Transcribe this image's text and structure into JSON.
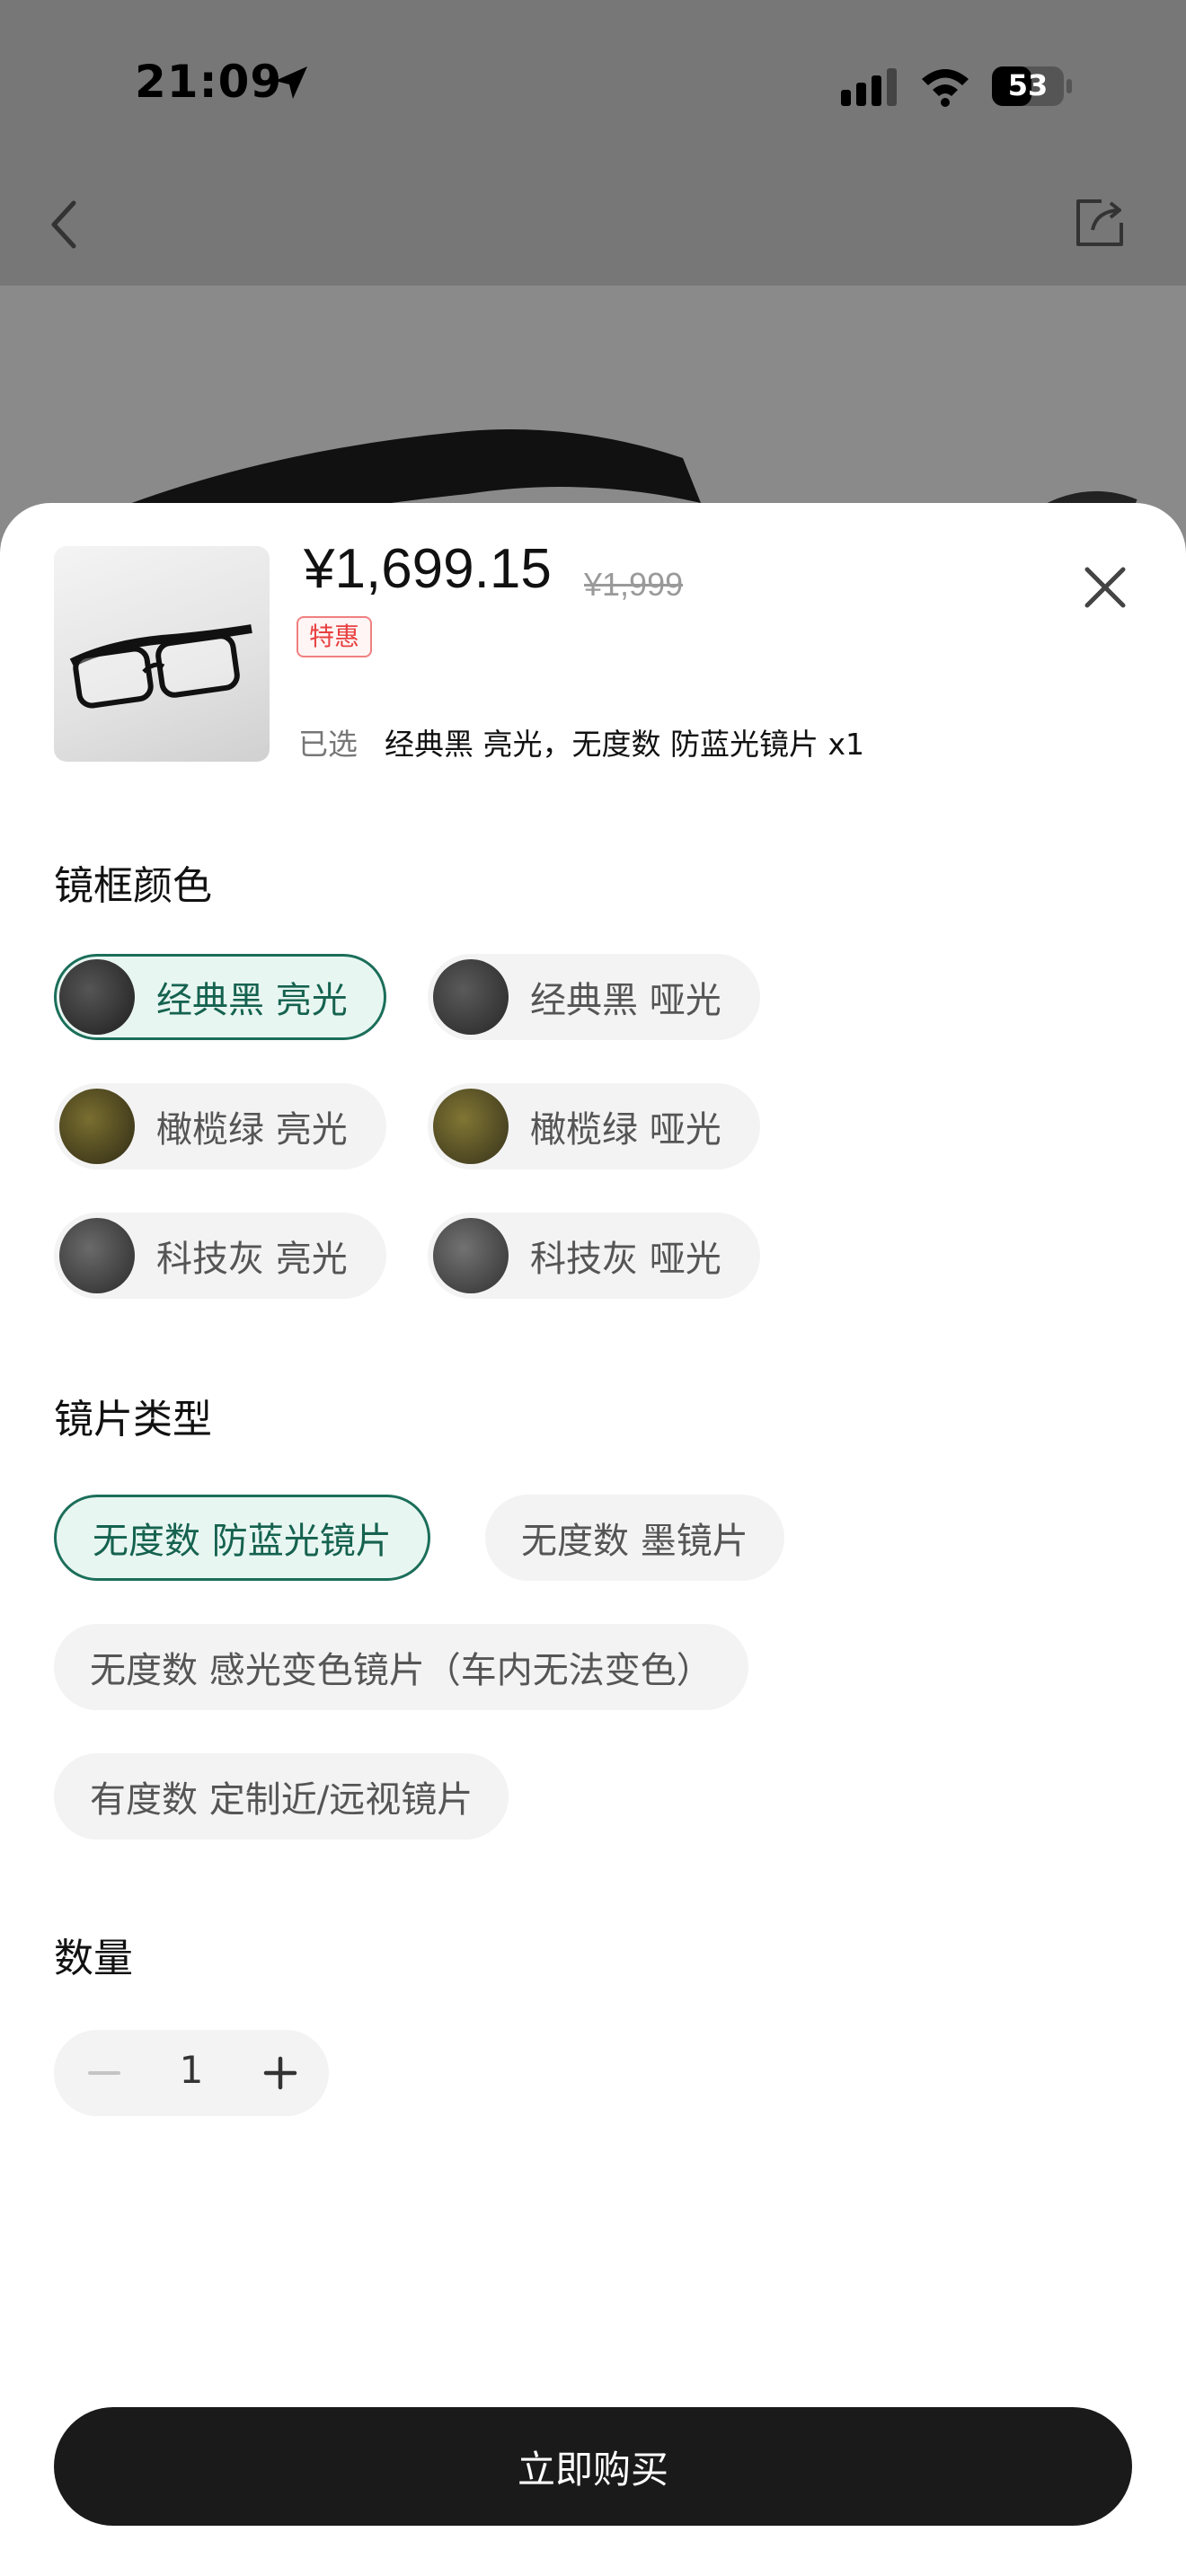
{
  "status_bar": {
    "time": "21:09",
    "battery": "53"
  },
  "product": {
    "price": "¥1,699.15",
    "original_price": "¥1,999",
    "badge": "特惠",
    "selected_label": "已选",
    "selected_value": "经典黑 亮光，无度数 防蓝光镜片 x1"
  },
  "frame_color": {
    "title": "镜框颜色",
    "options": [
      {
        "label": "经典黑 亮光",
        "selected": true,
        "swatch": "#2a2a2a"
      },
      {
        "label": "经典黑 哑光",
        "selected": false,
        "swatch": "#333333"
      },
      {
        "label": "橄榄绿 亮光",
        "selected": false,
        "swatch": "#4a4420"
      },
      {
        "label": "橄榄绿 哑光",
        "selected": false,
        "swatch": "#545025"
      },
      {
        "label": "科技灰 亮光",
        "selected": false,
        "swatch": "#3c3c3c"
      },
      {
        "label": "科技灰 哑光",
        "selected": false,
        "swatch": "#444444"
      }
    ]
  },
  "lens_type": {
    "title": "镜片类型",
    "options": [
      {
        "label": "无度数 防蓝光镜片",
        "selected": true
      },
      {
        "label": "无度数 墨镜片",
        "selected": false
      },
      {
        "label": "无度数 感光变色镜片（车内无法变色）",
        "selected": false
      },
      {
        "label": "有度数 定制近/远视镜片",
        "selected": false
      }
    ]
  },
  "quantity": {
    "title": "数量",
    "value": "1"
  },
  "buy_button": {
    "label": "立即购买"
  },
  "colors": {
    "accent": "#1b6e5a",
    "accent_bg": "#e8f6f1",
    "deal_red": "#e84040",
    "button_bg": "#1a1a1a"
  }
}
